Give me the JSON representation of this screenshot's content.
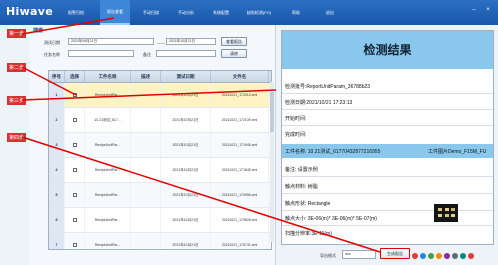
{
  "app": {
    "logo": "Hiwave"
  },
  "nav": [
    {
      "label": "报警归档"
    },
    {
      "label": "报告查看"
    },
    {
      "label": "手动扫描"
    },
    {
      "label": "手动分析"
    },
    {
      "label": "系统配置"
    },
    {
      "label": "缺陷检测(FO)"
    },
    {
      "label": "帮助"
    },
    {
      "label": "退出"
    }
  ],
  "search": {
    "section_title": "搜索",
    "date_label": "测试日期",
    "date_from": "2021年09月21日",
    "date_sep": "——",
    "date_to": "2021年10月21日",
    "task_label": "任务名称",
    "remark_label": "备注",
    "query_button": "查看报告",
    "clear_button": "清除"
  },
  "table": {
    "headers": [
      "序号",
      "选择",
      "工件名称",
      "描述",
      "测试日期",
      "文件名"
    ],
    "rows": [
      {
        "idx": "1",
        "name": "RecipeUnitPar...",
        "desc": "",
        "date": "2021年10月21日",
        "file": "20211021_172313.xml"
      },
      {
        "idx": "2",
        "name": "10.21测试_617...",
        "desc": "",
        "date": "2021年10月21日",
        "file": "20211021_172139.xml"
      },
      {
        "idx": "3",
        "name": "RecipeUnitPar...",
        "desc": "",
        "date": "2021年10月21日",
        "file": "20211021_171945.xml"
      },
      {
        "idx": "4",
        "name": "RecipeUnitPar...",
        "desc": "",
        "date": "2021年10月21日",
        "file": "20211021_171845.xml"
      },
      {
        "idx": "5",
        "name": "RecipeUnitPar...",
        "desc": "",
        "date": "2021年10月21日",
        "file": "20211021_170956.xml"
      },
      {
        "idx": "6",
        "name": "RecipeUnitPar...",
        "desc": "",
        "date": "2021年10月21日",
        "file": "20211021_170826.xml"
      },
      {
        "idx": "7",
        "name": "RecipeUnitPar...",
        "desc": "",
        "date": "2021年10月21日",
        "file": "20211021_170741.xml"
      }
    ]
  },
  "result": {
    "title": "检测结果",
    "batch": "检测批号:ReportUnitParam_36788b23",
    "date": "检测日期:2021/10/21 17:23:13",
    "start": "开始时间:",
    "finish": "完成时间:",
    "part_name": "工件名称: 10.21测试_61770432877216955",
    "part_image": "工件图片Demo_F15M_FU",
    "remark": "备注: 设置示例",
    "material": "触点材料: 树脂",
    "shape": "触点形状: Rectangle",
    "size": "触点大小: 3E-06(m)* 3E-06(m)* 5E-07(m)",
    "scan_gap": "扫描分辨率:3E-11(m)"
  },
  "footer": {
    "export_label": "导出格式",
    "export_format": "doc",
    "generate_button": "生成报告"
  },
  "annotations": [
    "第一步",
    "第二步",
    "第三步",
    "第四步"
  ],
  "colors": {
    "topbar": "#1957a8",
    "accent": "#8ac7ec",
    "annotation": "#e10000"
  }
}
